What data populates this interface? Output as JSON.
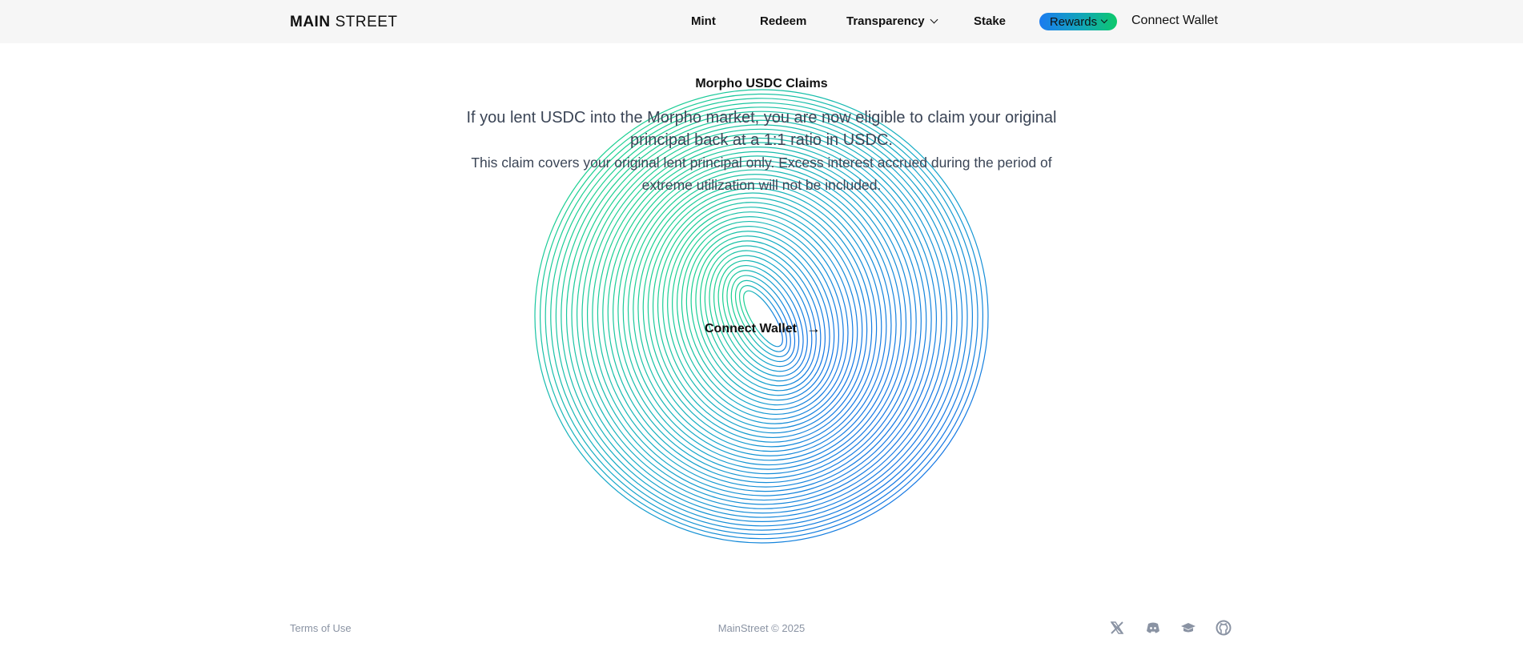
{
  "header": {
    "logo_main": "MAIN",
    "logo_street": "STREET",
    "nav": [
      {
        "label": "Mint"
      },
      {
        "label": "Redeem"
      },
      {
        "label": "Transparency"
      },
      {
        "label": "Stake"
      }
    ],
    "rewards_label": "Rewards",
    "connect_wallet_label": "Connect Wallet"
  },
  "main": {
    "title": "Morpho USDC Claims",
    "description_primary": "If you lent USDC into the Morpho market, you are now eligible to claim your original principal back at a 1:1 ratio in USDC.",
    "description_secondary": "This claim covers your original lent principal only. Excess interest accrued during the period of extreme utilization will not be included.",
    "connect_wallet_label": "Connect Wallet",
    "arrow_icon": "arrow-right-icon",
    "accent_colors": {
      "blue": "#1b7bf0",
      "green": "#0dc96b"
    }
  },
  "footer": {
    "terms_label": "Terms of Use",
    "copyright": "MainStreet © 2025",
    "social_icons": [
      "x-icon",
      "discord-icon",
      "docs-icon",
      "github-icon"
    ],
    "icon_color": "#8a93a3"
  }
}
